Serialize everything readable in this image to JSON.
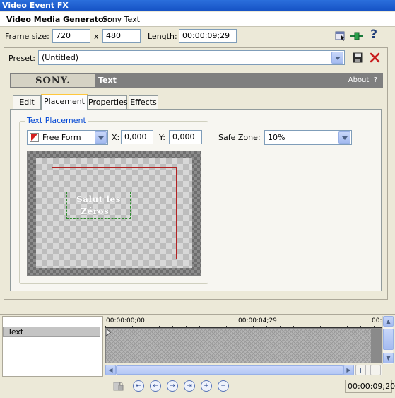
{
  "window": {
    "title": "Video Event FX"
  },
  "generator": {
    "label": "Video Media Generator:",
    "name": "Sony Text"
  },
  "frame": {
    "label": "Frame size:",
    "width": "720",
    "separator": "x",
    "height": "480",
    "length_label": "Length:",
    "length": "00:00:09;29"
  },
  "toolbar": {
    "help_label": "?"
  },
  "preset": {
    "label": "Preset:",
    "value": "(Untitled)"
  },
  "plugin": {
    "brand": "SONY.",
    "title": "Text",
    "about": "About",
    "help": "?"
  },
  "tabs": [
    {
      "label": "Edit"
    },
    {
      "label": "Placement"
    },
    {
      "label": "Properties"
    },
    {
      "label": "Effects"
    }
  ],
  "placement": {
    "group_label": "Text Placement",
    "mode": "Free Form",
    "x_label": "X:",
    "x_value": "0,000",
    "y_label": "Y:",
    "y_value": "0,000",
    "safe_zone_label": "Safe Zone:",
    "safe_zone_value": "10%",
    "preview_text_line1": "Salut les",
    "preview_text_line2": "Zéros !"
  },
  "timeline": {
    "track_name": "Text",
    "ruler_labels": [
      "00:00:00;00",
      "00:00:04;29",
      "00:"
    ],
    "current_time": "00:00:09;20"
  },
  "colors": {
    "safe_zone_border": "#b22222",
    "text_box_border": "#2e8b2e",
    "tab_highlight": "#ffc73c",
    "playhead": "#e06020"
  }
}
